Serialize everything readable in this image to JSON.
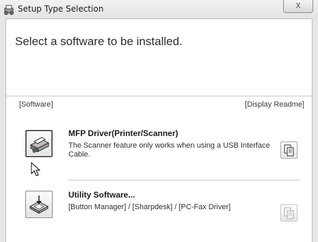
{
  "window": {
    "title": "Setup Type Selection",
    "close_symbol": "X"
  },
  "main": {
    "heading": "Select a software to be installed.",
    "software_label": "[Software]",
    "readme_label": "[Display Readme]"
  },
  "items": [
    {
      "title": "MFP Driver(Printer/Scanner)",
      "description_line1": "The Scanner feature only works when using a USB Interface",
      "description_line2": "Cable.",
      "icon": "printer-scanner-icon",
      "readme_icon": "readme-document-icon",
      "selected": true
    },
    {
      "title": "Utility Software...",
      "description_line1": "[Button Manager] / [Sharpdesk] / [PC-Fax Driver]",
      "icon": "utility-software-icon",
      "readme_icon": "readme-document-icon",
      "readme_disabled": true
    }
  ],
  "colors": {
    "window_frame": "#e6e6e6",
    "content_bg": "#ffffff",
    "divider": "#c8c8c8"
  }
}
